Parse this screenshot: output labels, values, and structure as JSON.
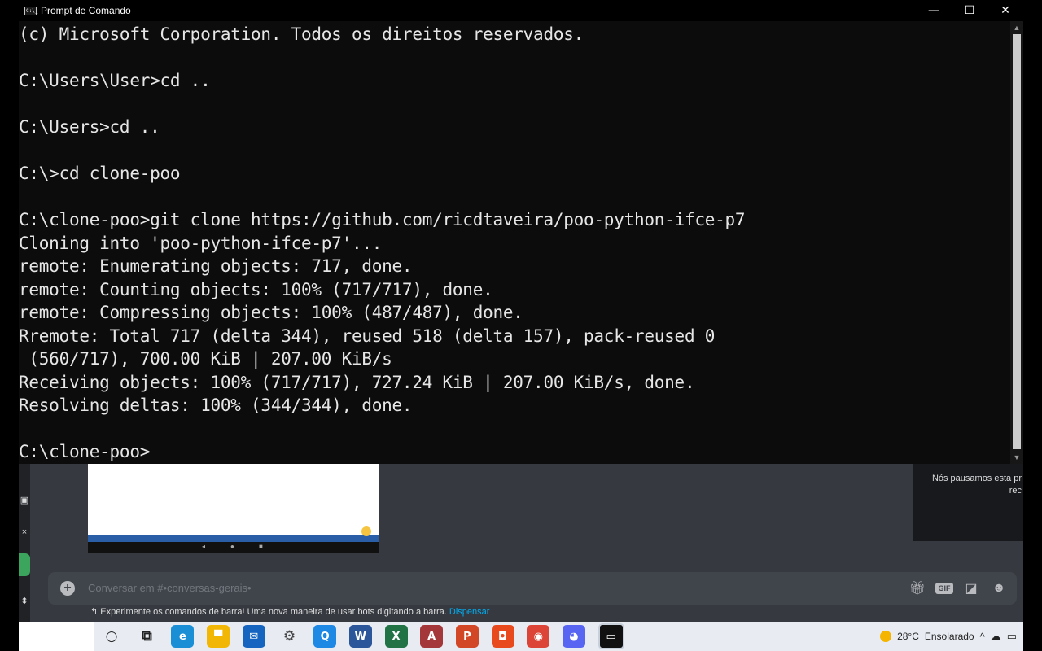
{
  "window": {
    "title": "Prompt de Comando",
    "icon_label": "C:\\_",
    "minimize": "—",
    "maximize": "☐",
    "close": "✕"
  },
  "terminal_lines": [
    "(c) Microsoft Corporation. Todos os direitos reservados.",
    "",
    "C:\\Users\\User>cd ..",
    "",
    "C:\\Users>cd ..",
    "",
    "C:\\>cd clone-poo",
    "",
    "C:\\clone-poo>git clone https://github.com/ricdtaveira/poo-python-ifce-p7",
    "Cloning into 'poo-python-ifce-p7'...",
    "remote: Enumerating objects: 717, done.",
    "remote: Counting objects: 100% (717/717), done.",
    "remote: Compressing objects: 100% (487/487), done.",
    "Rremote: Total 717 (delta 344), reused 518 (delta 157), pack-reused 0",
    " (560/717), 700.00 KiB | 207.00 KiB/s",
    "Receiving objects: 100% (717/717), 727.24 KiB | 207.00 KiB/s, done.",
    "Resolving deltas: 100% (344/344), done.",
    "",
    "C:\\clone-poo>"
  ],
  "discord": {
    "chat_placeholder": "Conversar em #•conversas-gerais•",
    "add_symbol": "+",
    "gif_label": "GIF",
    "stream_message": "Nós pausamos esta pr rec",
    "stream_message_line1": "Nós pausamos esta pr",
    "stream_message_line2": "rec",
    "tip_text": "Experimente os comandos de barra! Uma nova maneira de usar bots digitando a barra.",
    "tip_link": "Dispensar",
    "tip_icon": "↰",
    "rail_icons": [
      "▣",
      "×",
      "⬍"
    ],
    "embed_nav": [
      "◂",
      "●",
      "■"
    ]
  },
  "taskbar": {
    "icons": [
      {
        "name": "search",
        "glyph": "○",
        "color": "#222222"
      },
      {
        "name": "task-view",
        "glyph": "⧉",
        "color": "#222222"
      },
      {
        "name": "edge",
        "glyph": "e",
        "color": "#1a8fd6"
      },
      {
        "name": "file-explorer",
        "glyph": "▀",
        "color": "#f2b705"
      },
      {
        "name": "mail",
        "glyph": "✉",
        "color": "#1565c0"
      },
      {
        "name": "settings",
        "glyph": "⚙",
        "color": "#444444"
      },
      {
        "name": "app-q",
        "glyph": "Q",
        "color": "#1e88e5"
      },
      {
        "name": "word",
        "glyph": "W",
        "color": "#2b579a"
      },
      {
        "name": "excel",
        "glyph": "X",
        "color": "#217346"
      },
      {
        "name": "access",
        "glyph": "A",
        "color": "#a4373a"
      },
      {
        "name": "powerpoint",
        "glyph": "P",
        "color": "#d24726"
      },
      {
        "name": "app-orange",
        "glyph": "◘",
        "color": "#e8491d"
      },
      {
        "name": "chrome",
        "glyph": "◉",
        "color": "#db4437"
      },
      {
        "name": "discord",
        "glyph": "◕",
        "color": "#5865f2"
      },
      {
        "name": "command-prompt",
        "glyph": "▭",
        "color": "#111111"
      }
    ],
    "temperature": "28°C",
    "weather": "Ensolarado",
    "tray_symbols": [
      "^",
      "☁",
      "▭"
    ]
  },
  "colors": {
    "terminal_bg": "#0c0c0c",
    "terminal_text": "#e6e6e6",
    "discord_bg": "#36393f",
    "discord_link": "#00aff4",
    "taskbar_bg": "#e8ecf2"
  }
}
